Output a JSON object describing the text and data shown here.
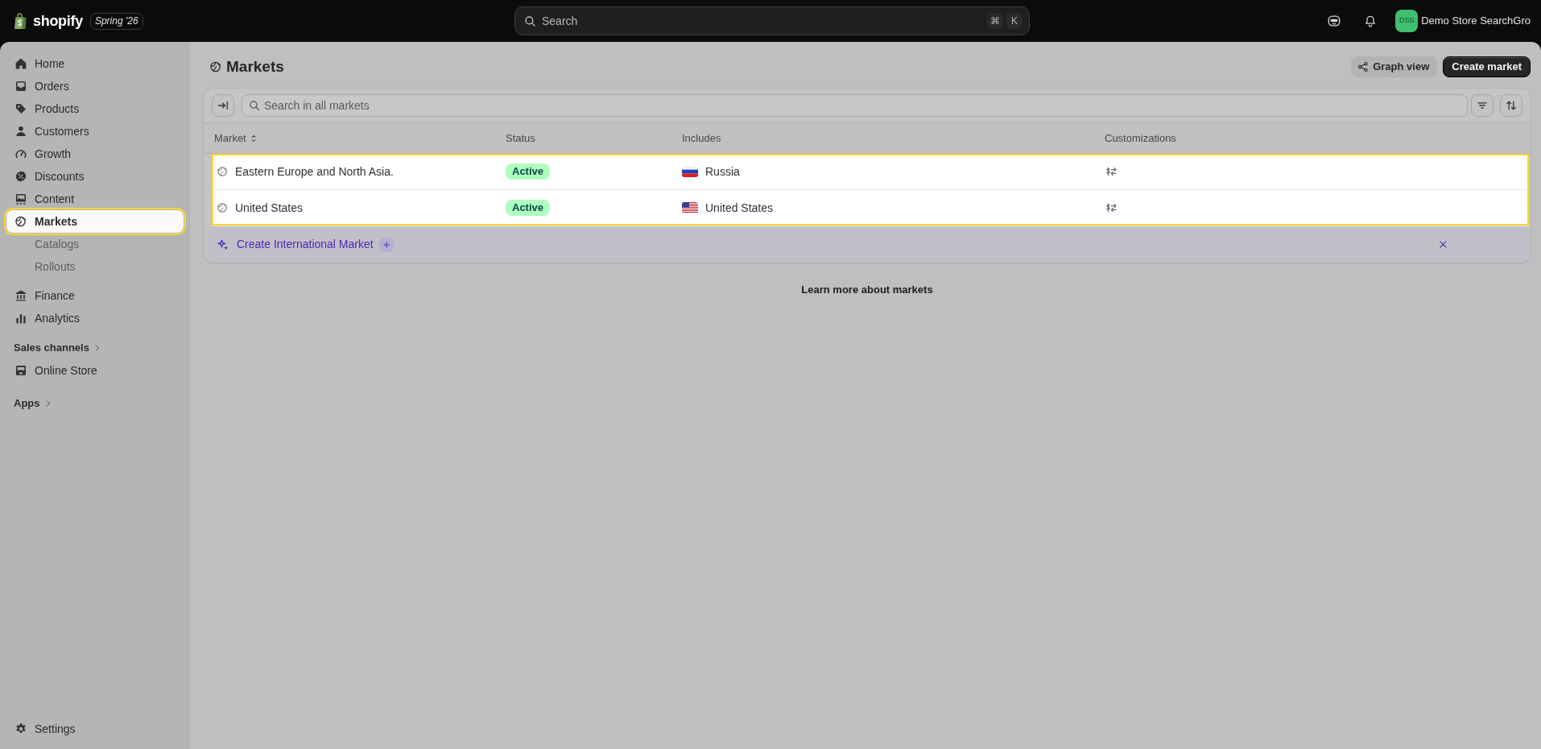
{
  "top_bar": {
    "logo": {
      "wordmark": "shopify",
      "edition": "Spring '26"
    },
    "search": {
      "placeholder": "Search",
      "shortcut": [
        "⌘",
        "K"
      ]
    },
    "store": {
      "initials": "DSS",
      "name": "Demo Store SearchGro"
    }
  },
  "sidebar": {
    "items": [
      {
        "label": "Home",
        "selected": false,
        "highlighted": false
      },
      {
        "label": "Orders",
        "selected": false,
        "highlighted": false
      },
      {
        "label": "Products",
        "selected": false,
        "highlighted": false
      },
      {
        "label": "Customers",
        "selected": false,
        "highlighted": false
      },
      {
        "label": "Growth",
        "selected": false,
        "highlighted": false
      },
      {
        "label": "Discounts",
        "selected": false,
        "highlighted": false
      },
      {
        "label": "Content",
        "selected": false,
        "highlighted": false
      },
      {
        "label": "Markets",
        "selected": true,
        "highlighted": true,
        "children": [
          {
            "label": "Catalogs",
            "selected": false
          },
          {
            "label": "Rollouts",
            "selected": false
          }
        ]
      },
      {
        "label": "Finance",
        "selected": false,
        "highlighted": false
      },
      {
        "label": "Analytics",
        "selected": false,
        "highlighted": false
      }
    ],
    "sales_channels": {
      "heading": "Sales channels",
      "items": [
        {
          "label": "Online Store",
          "selected": false
        }
      ]
    },
    "apps": {
      "heading": "Apps"
    },
    "settings": {
      "label": "Settings",
      "selected": false
    }
  },
  "page": {
    "title": "Markets",
    "actions": [
      {
        "label": "Graph view",
        "kind": "secondary"
      },
      {
        "label": "Create market",
        "kind": "primary"
      }
    ],
    "table": {
      "search": {
        "placeholder": "Search in all markets"
      },
      "columns": [
        {
          "label": "Market",
          "sortable": true
        },
        {
          "label": "Status",
          "sortable": false
        },
        {
          "label": "Includes",
          "sortable": false
        },
        {
          "label": "Customizations",
          "sortable": false
        }
      ],
      "rows": [
        {
          "market": "Eastern Europe and North Asia.",
          "status": "Active",
          "includes": "Russia",
          "highlighted": true
        },
        {
          "market": "United States",
          "status": "Active",
          "includes": "United States",
          "highlighted": true
        }
      ],
      "promo": {
        "label": "Create International Market"
      }
    },
    "learn_more": "Learn more about markets"
  }
}
